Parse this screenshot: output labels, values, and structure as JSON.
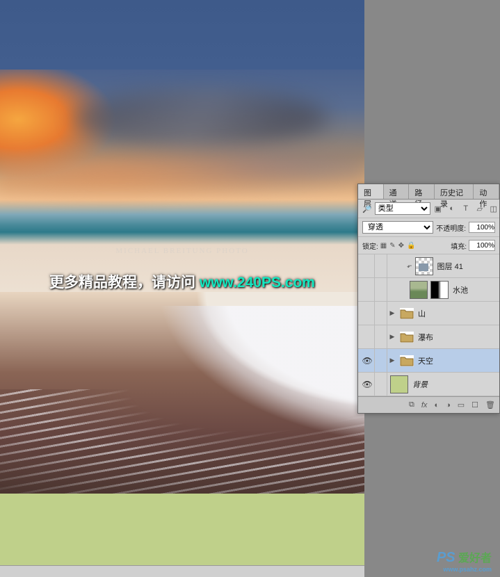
{
  "watermark": {
    "text_prefix": "更多精品教程，请访问 ",
    "url": "www.240PS.com",
    "photo_credit": "MICHAEL BREITUNG PHOTO"
  },
  "bottom_brand": {
    "logo_ps": "PS",
    "logo_text": "爱好者",
    "domain": "www.psahz.com"
  },
  "panel": {
    "tabs": [
      "图层",
      "通道",
      "路径",
      "历史记录",
      "动作"
    ],
    "active_tab_index": 0,
    "kind_label": "类型",
    "blend_mode": "穿透",
    "opacity_label": "不透明度:",
    "opacity_value": "100%",
    "lock_label": "锁定:",
    "fill_label": "填充:",
    "fill_value": "100%",
    "filter_icons": [
      "image-filter-icon",
      "adjust-filter-icon",
      "text-filter-icon",
      "shape-filter-icon",
      "smart-filter-icon"
    ],
    "layers": [
      {
        "visible": false,
        "type": "layer",
        "thumb": "transparent",
        "name": "图层 41",
        "indent": true
      },
      {
        "visible": false,
        "type": "layer-masked",
        "thumb": "pond",
        "name": "水池",
        "indent": true
      },
      {
        "visible": false,
        "type": "group",
        "name": "山",
        "expanded": false
      },
      {
        "visible": false,
        "type": "group",
        "name": "瀑布",
        "expanded": false
      },
      {
        "visible": true,
        "type": "group",
        "name": "天空",
        "expanded": false,
        "selected": true
      },
      {
        "visible": true,
        "type": "layer",
        "thumb": "green",
        "name": "背景",
        "italic": true
      }
    ],
    "footer_icons": [
      "link-icon",
      "fx-icon",
      "mask-icon",
      "adjustment-icon",
      "group-icon",
      "new-icon",
      "trash-icon"
    ]
  }
}
